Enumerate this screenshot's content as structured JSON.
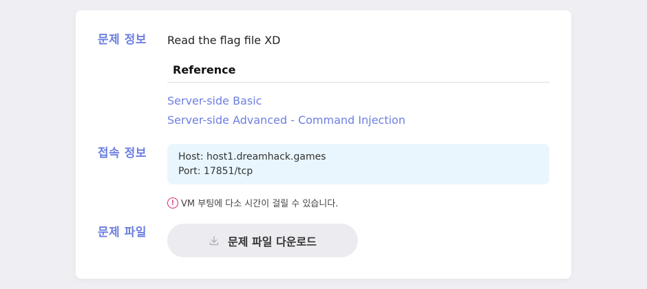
{
  "sections": {
    "problem_info": "문제 정보",
    "connection_info": "접속 정보",
    "problem_file": "문제 파일"
  },
  "description": "Read the flag file XD",
  "reference": {
    "heading": "Reference",
    "links": [
      "Server-side Basic",
      "Server-side Advanced - Command Injection"
    ]
  },
  "connection": {
    "host": "Host: host1.dreamhack.games",
    "port": "Port: 17851/tcp"
  },
  "warning": {
    "icon": "exclamation-circle-icon",
    "text": "VM 부팅에 다소 시간이 걸릴 수 있습니다."
  },
  "download": {
    "icon": "download-icon",
    "label": "문제 파일 다운로드"
  },
  "colors": {
    "accent": "#6c7ee1",
    "warning": "#d6246e",
    "conn_bg": "#e9f6fd",
    "page_bg": "#efeff3"
  }
}
